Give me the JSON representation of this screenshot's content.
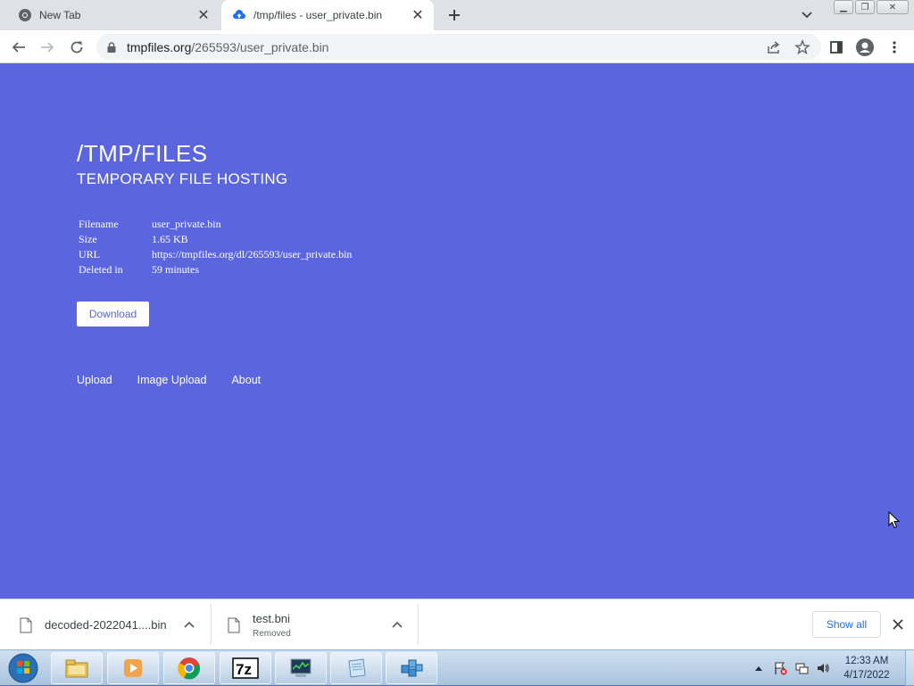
{
  "browser": {
    "tabs": [
      {
        "title": "New Tab",
        "active": false,
        "favicon": "chrome-icon"
      },
      {
        "title": "/tmp/files - user_private.bin",
        "active": true,
        "favicon": "cloud-upload-icon"
      }
    ],
    "url": {
      "host": "tmpfiles.org",
      "path": "/265593/user_private.bin"
    }
  },
  "page": {
    "title": "/TMP/FILES",
    "subtitle": "TEMPORARY FILE HOSTING",
    "info": [
      {
        "key": "Filename",
        "value": "user_private.bin"
      },
      {
        "key": "Size",
        "value": "1.65 KB"
      },
      {
        "key": "URL",
        "value": "https://tmpfiles.org/dl/265593/user_private.bin"
      },
      {
        "key": "Deleted in",
        "value": "59 minutes"
      }
    ],
    "download_label": "Download",
    "nav": [
      "Upload",
      "Image Upload",
      "About"
    ]
  },
  "downloads": {
    "items": [
      {
        "name": "decoded-2022041....bin",
        "status": ""
      },
      {
        "name": "test.bni",
        "status": "Removed"
      }
    ],
    "show_all_label": "Show all"
  },
  "taskbar": {
    "apps": [
      "windows-explorer-icon",
      "media-player-icon",
      "chrome-icon",
      "7zip-icon",
      "task-manager-icon",
      "notepad-icon",
      "registry-editor-icon"
    ],
    "clock": {
      "time": "12:33 AM",
      "date": "4/17/2022"
    }
  },
  "colors": {
    "page_bg": "#5a65de",
    "accent": "#1a73e8"
  }
}
